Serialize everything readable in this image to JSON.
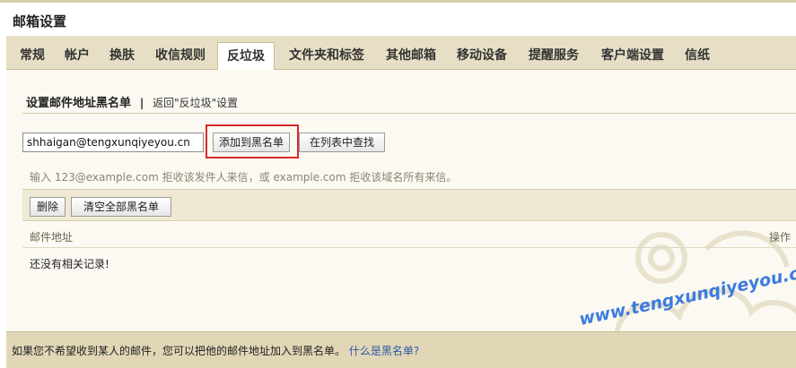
{
  "page": {
    "title": "邮箱设置"
  },
  "tabs": [
    {
      "label": "常规",
      "active": false
    },
    {
      "label": "帐户",
      "active": false
    },
    {
      "label": "换肤",
      "active": false
    },
    {
      "label": "收信规则",
      "active": false
    },
    {
      "label": "反垃圾",
      "active": true
    },
    {
      "label": "文件夹和标签",
      "active": false
    },
    {
      "label": "其他邮箱",
      "active": false
    },
    {
      "label": "移动设备",
      "active": false
    },
    {
      "label": "提醒服务",
      "active": false
    },
    {
      "label": "客户端设置",
      "active": false
    },
    {
      "label": "信纸",
      "active": false
    }
  ],
  "section": {
    "heading": "设置邮件地址黑名单",
    "separator": "|",
    "back_link": "返回\"反垃圾\"设置"
  },
  "form": {
    "email_value": "shhaigan@tengxunqiyeyou.cn",
    "add_label": "添加到黑名单",
    "search_label": "在列表中查找",
    "hint": "输入 123@example.com 拒收该发件人来信，或 example.com 拒收该域名所有来信。"
  },
  "list": {
    "delete_label": "删除",
    "clear_all_label": "清空全部黑名单",
    "columns": {
      "address": "邮件地址",
      "operation": "操作"
    },
    "empty_text": "还没有相关记录!"
  },
  "footer": {
    "text": "如果您不希望收到某人的邮件，您可以把他的邮件地址加入到黑名单。",
    "link": "什么是黑名单?"
  },
  "watermark": "www.tengxunqiyeyou.com",
  "colors": {
    "highlight": "#d92a2a",
    "watermark": "#3c7be0",
    "tab_bar": "#e7dfc5"
  }
}
